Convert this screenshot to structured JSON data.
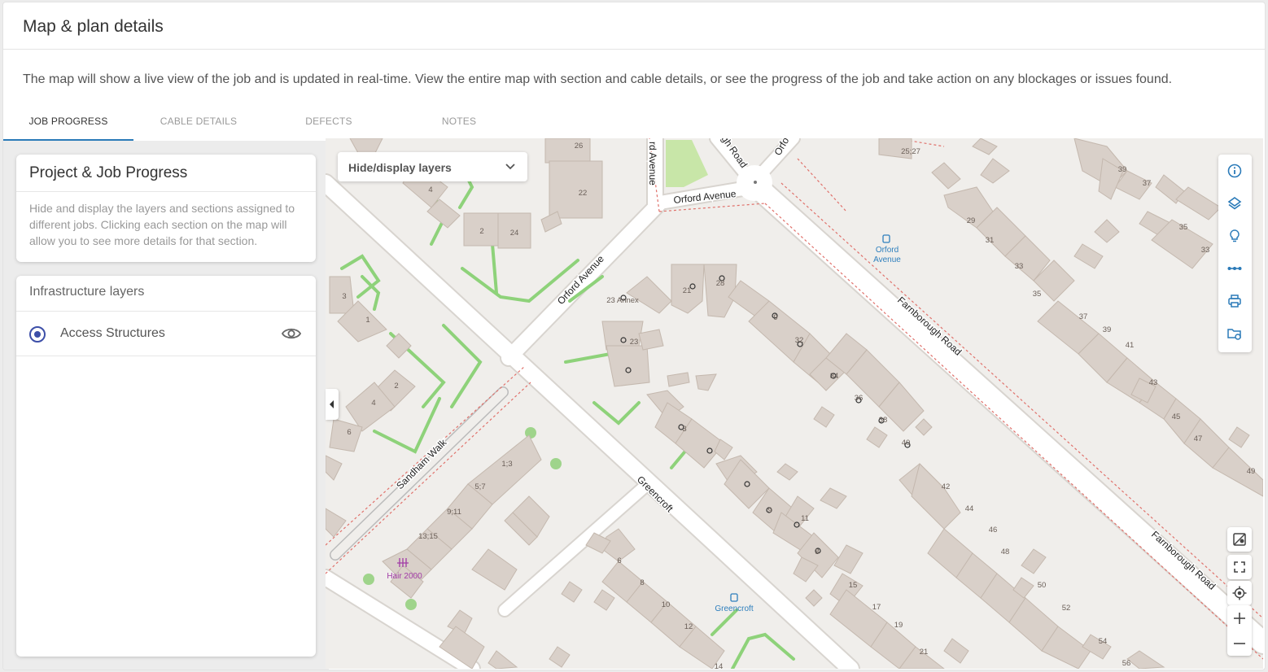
{
  "header": {
    "title": "Map & plan details"
  },
  "description": "The map will show a live view of the job and is updated in real-time. View the entire map with section and cable details, or see the progress of the job and take action on any blockages or issues found.",
  "tabs": [
    {
      "label": "JOB PROGRESS",
      "active": true
    },
    {
      "label": "CABLE DETAILS",
      "active": false
    },
    {
      "label": "DEFECTS",
      "active": false
    },
    {
      "label": "NOTES",
      "active": false
    }
  ],
  "project_panel": {
    "title": "Project & Job Progress",
    "text": "Hide and display the layers and sections assigned to different jobs. Clicking each section on the map will allow you to see more details for that section."
  },
  "layers_panel": {
    "title": "Infrastructure layers",
    "items": [
      {
        "label": "Access Structures",
        "selected": true,
        "visible": true
      }
    ]
  },
  "map": {
    "layer_dropdown": "Hide/display layers",
    "roads": {
      "orford_avenue_a": "Orford Avenue",
      "orford_avenue_b": "Orford Avenue",
      "orford_avenue_c": "rd Avenue",
      "orford_top": "Orfo",
      "farnborough_a": "Farnborough Road",
      "farnborough_b": "Farnborough Road",
      "farnborough_top": "gh Road",
      "greencroft": "Greencroft",
      "sandham_walk": "Sandham Walk"
    },
    "pois": {
      "bus_stop_1": "Orford Avenue",
      "bus_stop_1_line1": "Orford",
      "bus_stop_1_line2": "Avenue",
      "bus_stop_2": "Greencroft",
      "hair_salon": "Hair 2000"
    },
    "house_numbers": [
      "26",
      "22",
      "4",
      "2",
      "24",
      "3",
      "1",
      "2",
      "4",
      "6",
      "21",
      "28",
      "23 Annex",
      "23",
      "9",
      "32",
      "34",
      "36",
      "38",
      "40",
      "3",
      "25;27",
      "29",
      "31",
      "33",
      "35",
      "39",
      "37",
      "35",
      "33",
      "37",
      "39",
      "41",
      "43",
      "45",
      "47",
      "49",
      "1;3",
      "5;7",
      "9;11",
      "13;15",
      "6",
      "8",
      "10",
      "12",
      "14",
      "42",
      "44",
      "46",
      "48",
      "50",
      "52",
      "54",
      "56",
      "8",
      "9",
      "11",
      "15",
      "17",
      "19",
      "21"
    ]
  },
  "toolbar": [
    "info-icon",
    "layers-icon",
    "lightbulb-icon",
    "measure-icon",
    "print-icon",
    "folder-settings-icon"
  ],
  "map_controls": [
    "map-style-icon",
    "fullscreen-icon",
    "locate-icon",
    "zoom-in-icon",
    "zoom-out-icon"
  ],
  "colors": {
    "accent": "#2a7ab8",
    "radio": "#3d4fa8",
    "building": "#d9d0c9",
    "building_stroke": "#c4b8ae",
    "road": "#ffffff",
    "park": "#c8e6a8",
    "path_green": "#8ed27a",
    "boundary": "#e0716b",
    "poi_blue": "#2e7fbd",
    "poi_purple": "#a03aa6"
  }
}
